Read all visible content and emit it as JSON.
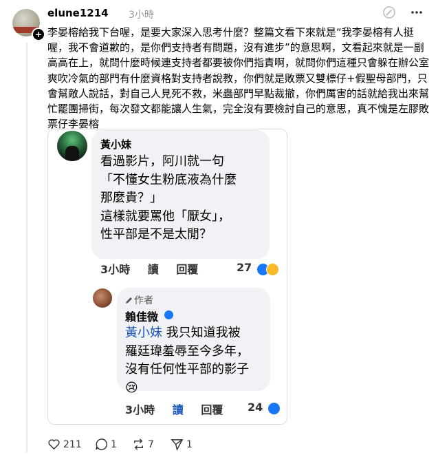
{
  "post": {
    "username": "elune1214",
    "time": "3小時",
    "text": "李晏榕給我下台喔，是要大家深入思考什麼？整篇文看下來就是“我李晏榕有人挺喔，我不會道歉的，是你們支持者有問題，沒有進步”的意思啊，文看起來就是一副高高在上，就問什麼時候連支持者都要被你們指責啊，就問你們這種只會躲在辦公室爽吹冷氣的部門有什麼資格對支持者說教，你們就是敗票又雙標仔+假聖母部門，只會幫敵人說話，對自己人見死不救，米蟲部門早點裁撤，你們厲害的話就給我出來幫忙罷團掃街，每次發文都能讓人生氣，完全沒有要檢討自己的意思，真不愧是左膠敗票仔李晏榕"
  },
  "comment1": {
    "name": "黃小妹",
    "lines": [
      "看過影片，阿川就一句",
      "「不懂女生粉底液為什麼",
      "那麼貴？」",
      "",
      "這樣就要罵他「厭女」，",
      "性平部是不是太閒？"
    ],
    "time": "3小時",
    "read": "讀",
    "reply": "回覆",
    "reactions": "27"
  },
  "comment2": {
    "author_label": "作者",
    "name": "賴佳微",
    "mention": "黃小妹",
    "lines_first": " 我只知道我被",
    "lines": [
      "羅廷瑋羞辱至今多年，",
      "沒有任何性平部的影子",
      "😢"
    ],
    "time": "3小時",
    "read": "讀",
    "reply": "回覆",
    "reactions": "24"
  },
  "actions": {
    "likes": "211",
    "comments": "1",
    "reposts": "7",
    "shares": "1"
  },
  "colors": {
    "like_blue": "#1877f2",
    "mention_blue": "#1a56b8",
    "haha_yellow": "#f7b928"
  }
}
